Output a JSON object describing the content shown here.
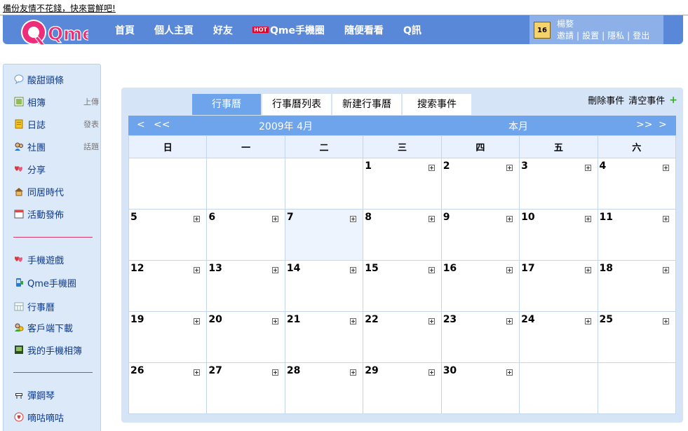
{
  "banner": {
    "text": "備份友情不花錢，快來嘗鮮吧!"
  },
  "header": {
    "brand": "Qme",
    "nav": [
      {
        "label": "首頁"
      },
      {
        "label": "個人主頁"
      },
      {
        "label": "好友"
      },
      {
        "badge": "HOT",
        "label": "Qme手機圈"
      },
      {
        "label": "隨便看看"
      },
      {
        "label": "Q訊"
      }
    ],
    "user": {
      "avatar_text": "16",
      "name": "楊婺",
      "links": [
        "邀請",
        "設置",
        "隱私",
        "登出"
      ]
    }
  },
  "sidebar": {
    "items": [
      {
        "label": "酸甜頭條",
        "icon": "speech-bubble-icon"
      },
      {
        "label": "相簿",
        "action": "上傳",
        "icon": "photo-icon"
      },
      {
        "label": "日誌",
        "action": "發表",
        "icon": "notebook-icon"
      },
      {
        "label": "社團",
        "action": "話題",
        "icon": "group-icon"
      },
      {
        "label": "分享",
        "icon": "hearts-icon"
      },
      {
        "label": "同居時代",
        "icon": "house-icon"
      },
      {
        "label": "活動發佈",
        "icon": "calendar-icon"
      },
      {
        "label": "手機遊戲",
        "icon": "game-icon"
      },
      {
        "label": "Qme手機圈",
        "icon": "phone-icon"
      },
      {
        "label": "行事曆",
        "icon": "schedule-icon"
      },
      {
        "label": "客戶端下載",
        "icon": "download-icon"
      },
      {
        "label": "我的手機相簿",
        "icon": "phone-album-icon"
      },
      {
        "label": "彈鋼琴",
        "icon": "piano-icon"
      },
      {
        "label": "嘀咕嘀咕",
        "icon": "chat-heart-icon"
      }
    ]
  },
  "calendar": {
    "tabs": [
      "行事曆",
      "行事曆列表",
      "新建行事曆",
      "搜索事件"
    ],
    "active_tab": 0,
    "actions": {
      "delete": "刪除事件",
      "clear": "清空事件"
    },
    "nav": {
      "prev": "<",
      "prev_prev": "<<",
      "month_label": "2009年  4月",
      "this_month": "本月",
      "next_next": ">>",
      "next": ">"
    },
    "weekdays": [
      "日",
      "一",
      "二",
      "三",
      "四",
      "五",
      "六"
    ],
    "today": 7,
    "weeks": [
      [
        "",
        "",
        "",
        "1",
        "2",
        "3",
        "4"
      ],
      [
        "5",
        "6",
        "7",
        "8",
        "9",
        "10",
        "11"
      ],
      [
        "12",
        "13",
        "14",
        "15",
        "16",
        "17",
        "18"
      ],
      [
        "19",
        "20",
        "21",
        "22",
        "23",
        "24",
        "25"
      ],
      [
        "26",
        "27",
        "28",
        "29",
        "30",
        "",
        ""
      ]
    ]
  },
  "colors": {
    "header": "#5a88d8",
    "accent": "#6ea4ec",
    "sidebar_bg": "#dce9f9",
    "panel_bg": "#d6e4f7",
    "divider": "#d23a6a"
  }
}
